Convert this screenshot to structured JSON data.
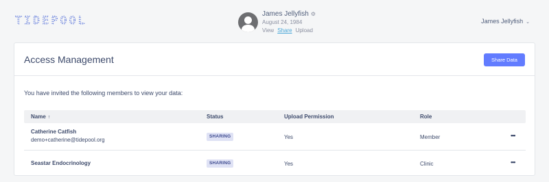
{
  "brand": {
    "logo_text": "TIDEPOOL"
  },
  "profile": {
    "name": "James Jellyfish",
    "dob": "August 24, 1984",
    "links": [
      {
        "label": "View",
        "active": false
      },
      {
        "label": "Share",
        "active": true
      },
      {
        "label": "Upload",
        "active": false
      }
    ]
  },
  "user_menu": {
    "label": "James Jellyfish"
  },
  "card": {
    "title": "Access Management",
    "share_button": "Share Data",
    "intro": "You have invited the following members to view your data:"
  },
  "table": {
    "columns": {
      "name": "Name",
      "status": "Status",
      "upload": "Upload Permission",
      "role": "Role"
    },
    "rows": [
      {
        "name": "Catherine Catfish",
        "email": "demo+catherine@tidepool.org",
        "status": "SHARING",
        "upload": "Yes",
        "role": "Member",
        "actions": "•••"
      },
      {
        "name": "Seastar Endocrinology",
        "email": "",
        "status": "SHARING",
        "upload": "Yes",
        "role": "Clinic",
        "actions": "•••"
      }
    ]
  },
  "colors": {
    "accent": "#627cff",
    "link_active": "#4aa7d8",
    "badge_bg": "#dfe2f5",
    "text": "#3d4a6b",
    "logo": "#4f6bd8"
  }
}
